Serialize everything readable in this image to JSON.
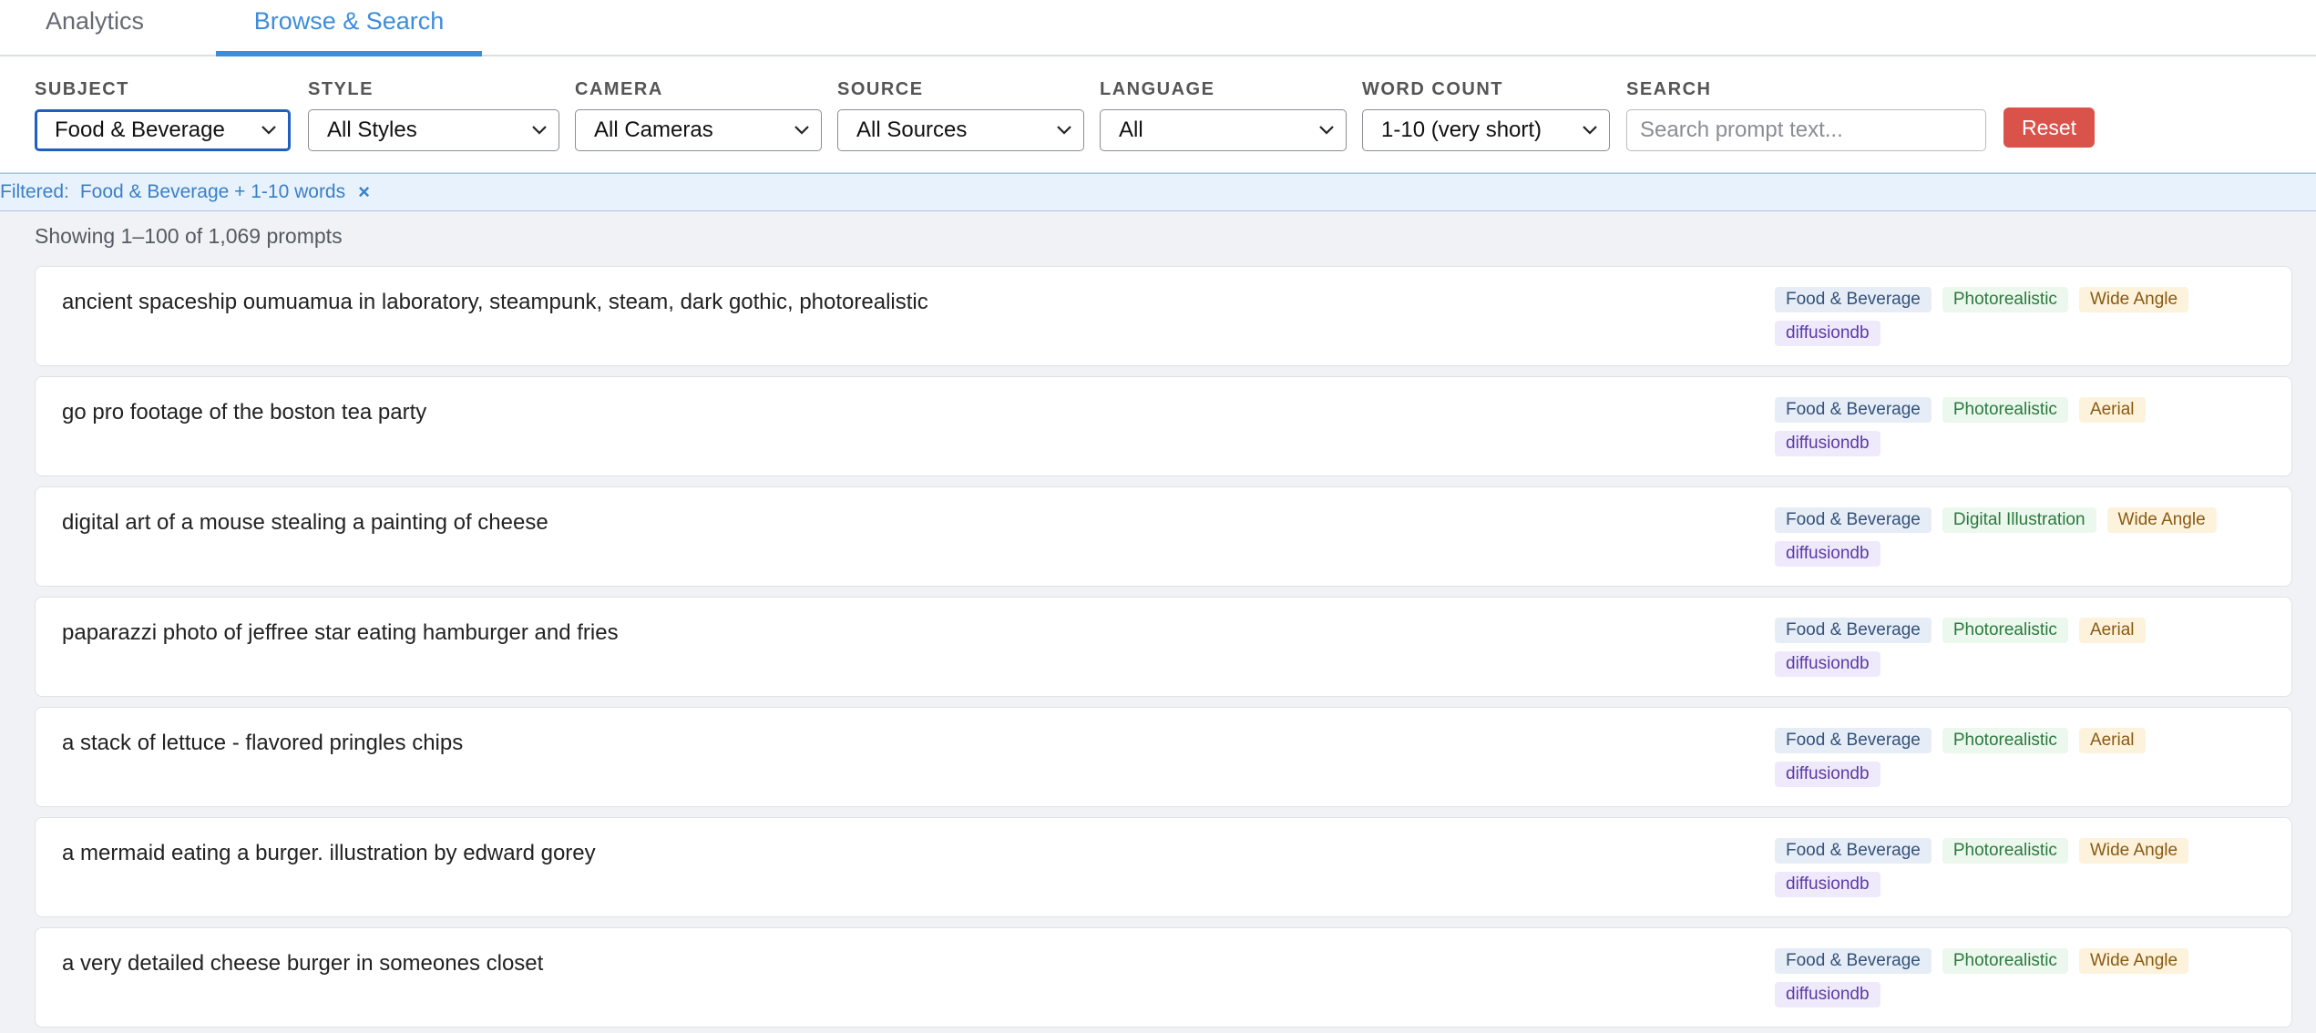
{
  "tabs": [
    {
      "label": "Analytics"
    },
    {
      "label": "Browse & Search"
    }
  ],
  "filters": {
    "subject": {
      "label": "SUBJECT",
      "value": "Food & Beverage"
    },
    "style": {
      "label": "STYLE",
      "value": "All Styles"
    },
    "camera": {
      "label": "CAMERA",
      "value": "All Cameras"
    },
    "source": {
      "label": "SOURCE",
      "value": "All Sources"
    },
    "language": {
      "label": "LANGUAGE",
      "value": "All"
    },
    "word_count": {
      "label": "WORD COUNT",
      "value": "1-10 (very short)"
    },
    "search": {
      "label": "SEARCH",
      "placeholder": "Search prompt text...",
      "value": ""
    },
    "reset_label": "Reset"
  },
  "banner": {
    "prefix": "Filtered:",
    "value": "Food & Beverage + 1-10 words",
    "clear_glyph": "×"
  },
  "results": {
    "count_text": "Showing 1–100 of 1,069 prompts",
    "items": [
      {
        "text": "ancient spaceship oumuamua in laboratory, steampunk, steam, dark gothic, photorealistic",
        "subject": "Food & Beverage",
        "style": "Photorealistic",
        "camera": "Wide Angle",
        "source": "diffusiondb"
      },
      {
        "text": "go pro footage of the boston tea party",
        "subject": "Food & Beverage",
        "style": "Photorealistic",
        "camera": "Aerial",
        "source": "diffusiondb"
      },
      {
        "text": "digital art of a mouse stealing a painting of cheese",
        "subject": "Food & Beverage",
        "style": "Digital Illustration",
        "camera": "Wide Angle",
        "source": "diffusiondb"
      },
      {
        "text": "paparazzi photo of jeffree star eating hamburger and fries",
        "subject": "Food & Beverage",
        "style": "Photorealistic",
        "camera": "Aerial",
        "source": "diffusiondb"
      },
      {
        "text": "a stack of lettuce - flavored pringles chips",
        "subject": "Food & Beverage",
        "style": "Photorealistic",
        "camera": "Aerial",
        "source": "diffusiondb"
      },
      {
        "text": "a mermaid eating a burger. illustration by edward gorey",
        "subject": "Food & Beverage",
        "style": "Photorealistic",
        "camera": "Wide Angle",
        "source": "diffusiondb"
      },
      {
        "text": "a very detailed cheese burger in someones closet",
        "subject": "Food & Beverage",
        "style": "Photorealistic",
        "camera": "Wide Angle",
        "source": "diffusiondb"
      }
    ]
  },
  "colors": {
    "accent": "#3d8dd9",
    "reset": "#d9534a",
    "active_select_border": "#1f5fbf"
  },
  "icons": {
    "select_arrow": "chevron-down-icon",
    "clear_filter": "close-icon"
  }
}
